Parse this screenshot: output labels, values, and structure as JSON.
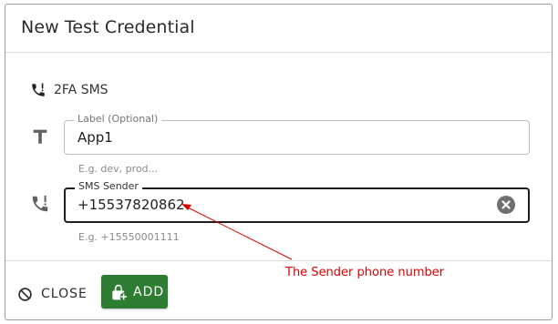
{
  "dialog": {
    "title": "New Test Credential",
    "credential_type": {
      "label": "2FA SMS",
      "icon": "phone-callback-icon"
    },
    "fields": [
      {
        "id": "label",
        "icon": "text-t-icon",
        "legend": "Label (Optional)",
        "value": "App1",
        "helper": "E.g. dev, prod..."
      },
      {
        "id": "sms_sender",
        "icon": "phone-alert-icon",
        "legend": "SMS Sender",
        "value": "+15537820862",
        "helper": "E.g. +15550001111"
      }
    ],
    "actions": {
      "close_label": "CLOSE",
      "add_label": "ADD"
    }
  },
  "annotation": {
    "text": "The Sender phone number",
    "color": "#e00000"
  },
  "colors": {
    "primary_button": "#2e7d32"
  }
}
